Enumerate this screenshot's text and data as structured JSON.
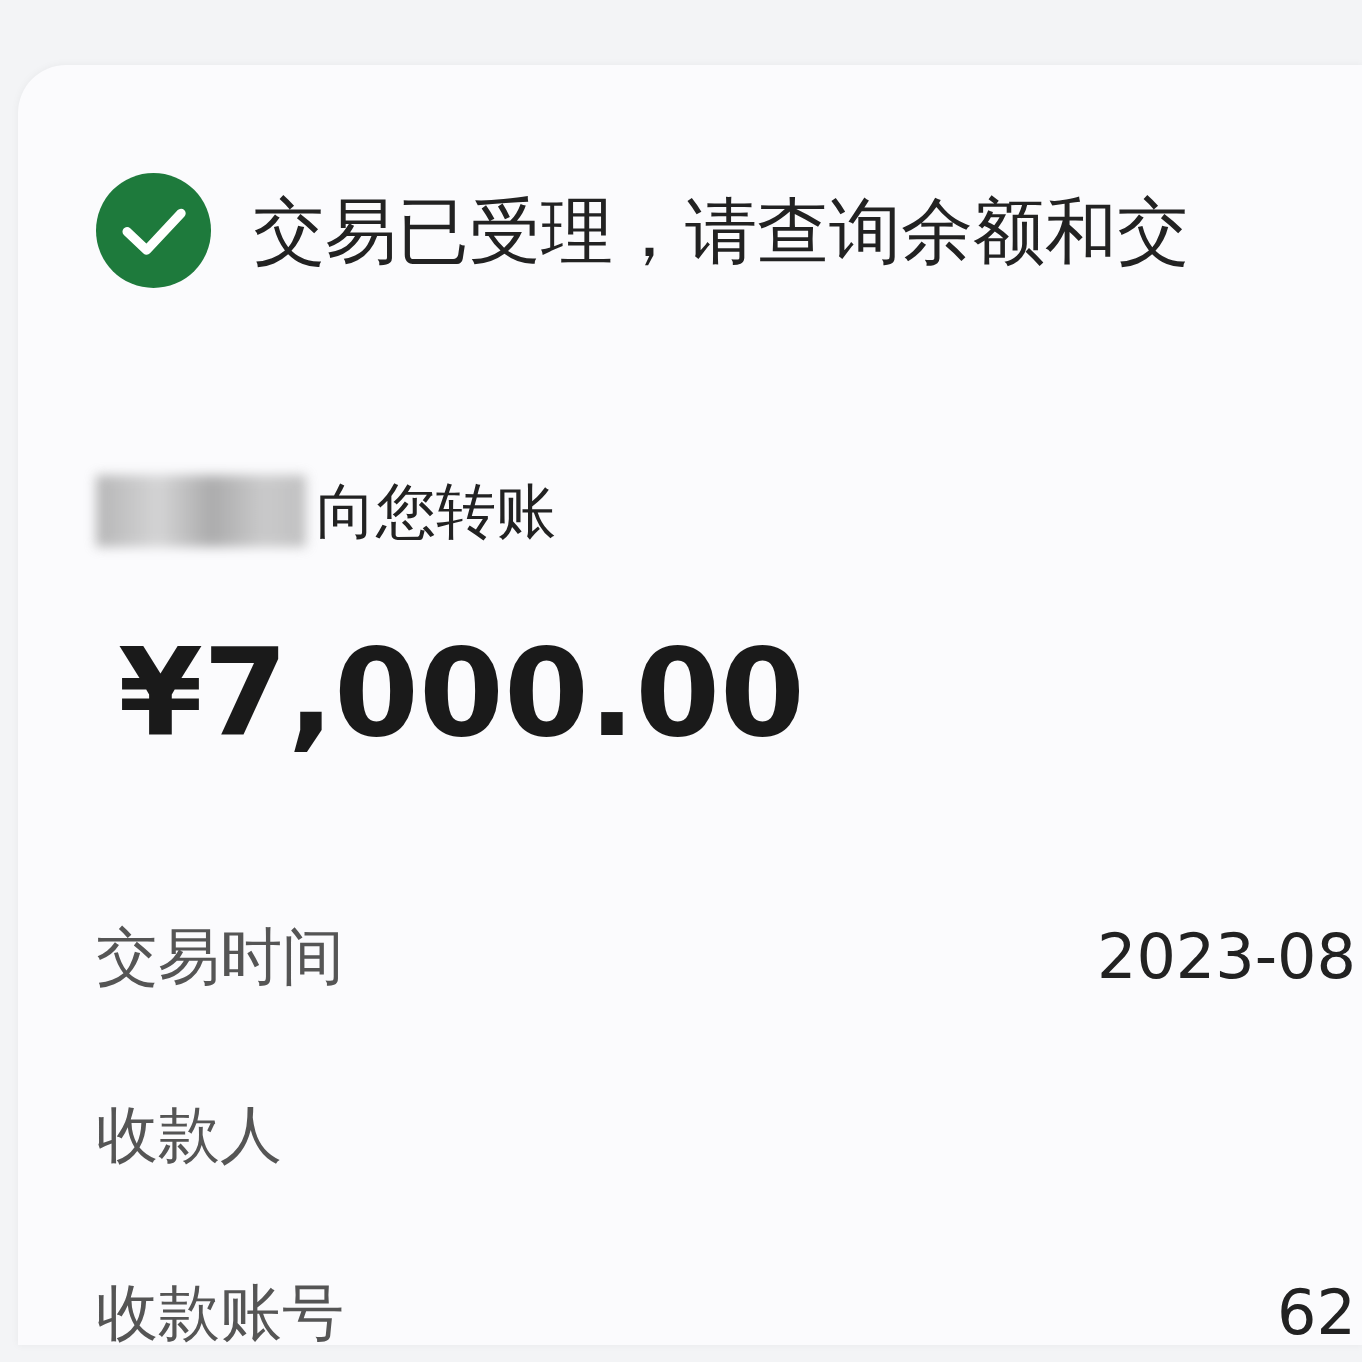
{
  "status": {
    "kind": "success",
    "message": "交易已受理，请查询余额和交"
  },
  "transfer": {
    "sender_redacted": true,
    "text": "向您转账",
    "amount": "¥7,000.00"
  },
  "details": [
    {
      "label": "交易时间",
      "value": "2023-08"
    },
    {
      "label": "收款人"
    },
    {
      "label": "收款账号",
      "value": "62"
    }
  ]
}
